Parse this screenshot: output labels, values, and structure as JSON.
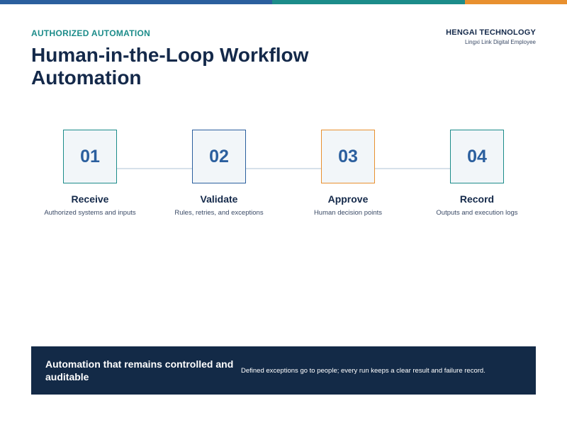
{
  "colors": {
    "accent_blue": "#2b5f9e",
    "accent_teal": "#1c8c8a",
    "accent_orange": "#e8902f",
    "navy": "#14294a"
  },
  "header": {
    "eyebrow": "AUTHORIZED AUTOMATION",
    "title": "Human-in-the-Loop Workflow Automation"
  },
  "brand": {
    "name": "HENGAI TECHNOLOGY",
    "subtitle": "Lingxi Link Digital Employee"
  },
  "steps": [
    {
      "number": "01",
      "title": "Receive",
      "description": "Authorized systems and inputs",
      "border_color": "#1c8c8a"
    },
    {
      "number": "02",
      "title": "Validate",
      "description": "Rules, retries, and exceptions",
      "border_color": "#2b5f9e"
    },
    {
      "number": "03",
      "title": "Approve",
      "description": "Human decision points",
      "border_color": "#e8902f"
    },
    {
      "number": "04",
      "title": "Record",
      "description": "Outputs and execution logs",
      "border_color": "#1c8c8a"
    }
  ],
  "banner": {
    "heading": "Automation that remains controlled and auditable",
    "text": "Defined exceptions go to people; every run keeps a clear result and failure record."
  }
}
